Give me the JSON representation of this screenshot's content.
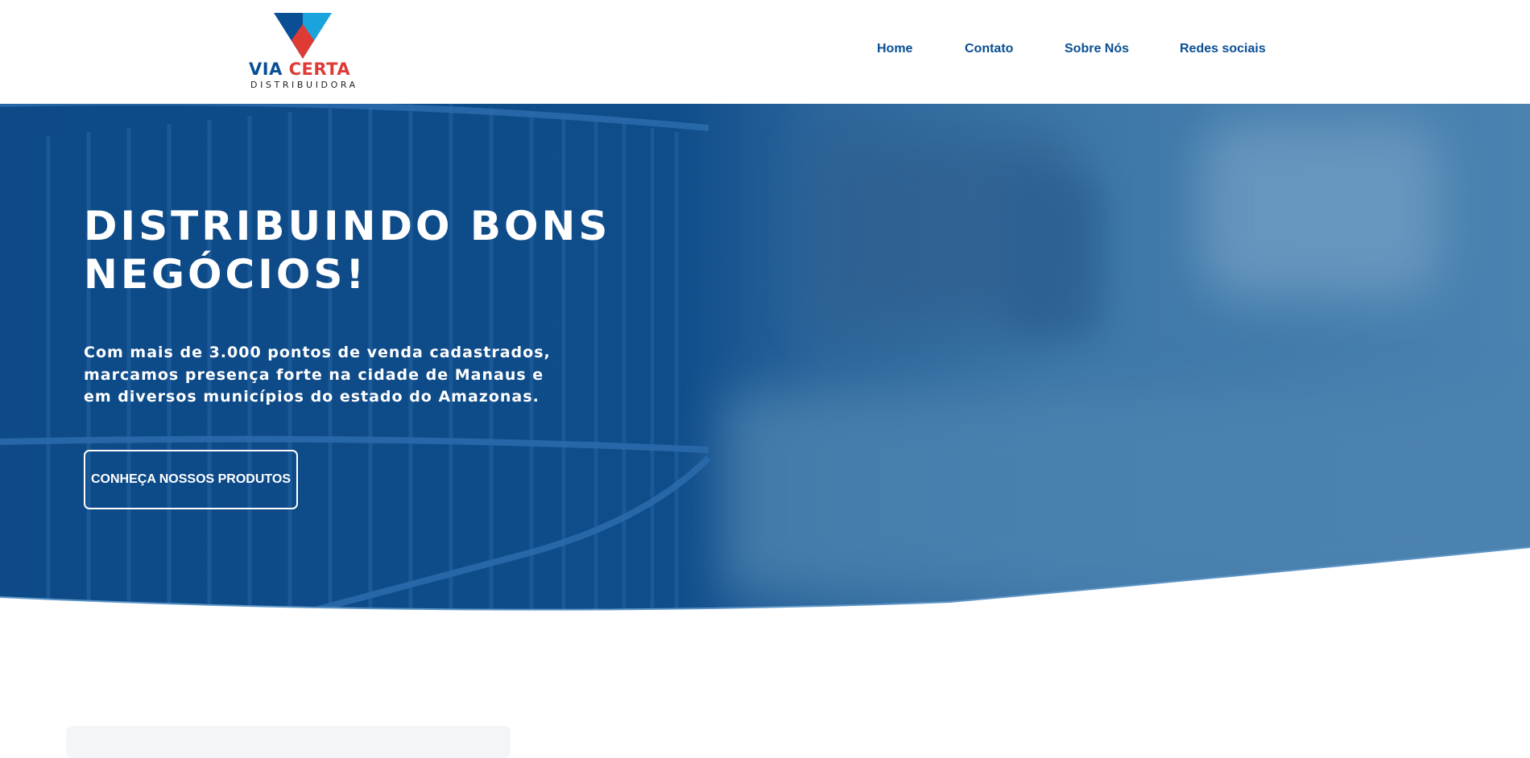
{
  "brand": {
    "name_part1": "VIA",
    "name_part2": "CERTA",
    "tagline": "DISTRIBUIDORA",
    "colors": {
      "blue": "#0a4f93",
      "red": "#e03a35",
      "light_blue": "#1aa3dc"
    }
  },
  "nav": {
    "items": [
      {
        "label": "Home"
      },
      {
        "label": "Contato"
      },
      {
        "label": "Sobre Nós"
      },
      {
        "label": "Redes sociais"
      }
    ]
  },
  "hero": {
    "title": "DISTRIBUINDO BONS NEGÓCIOS!",
    "description": "Com mais de 3.000 pontos de venda cadastrados, marcamos presença forte na cidade de Manaus e em diversos municípios do estado do Amazonas.",
    "cta_label": "CONHEÇA NOSSOS PRODUTOS",
    "overlay_color": "#0e4c8a"
  },
  "icons": {
    "logo_mark": "v-chevron-logo-icon"
  }
}
